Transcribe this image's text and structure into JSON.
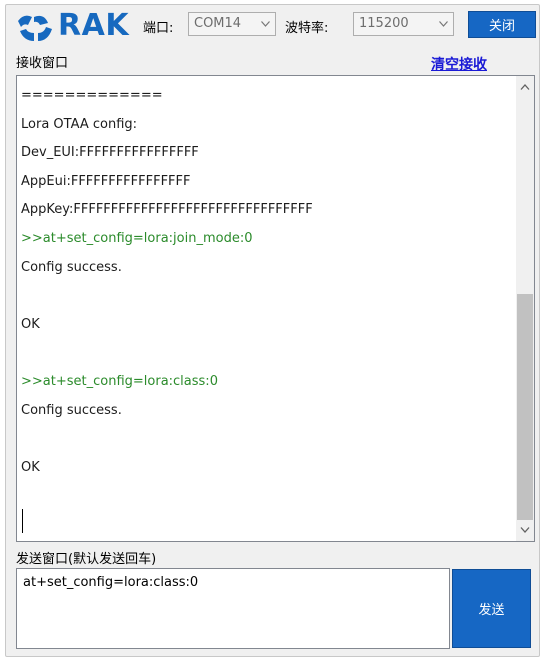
{
  "app": {
    "logo_text": "RAK",
    "brand_color": "#1769bf"
  },
  "header": {
    "port_label": "端口:",
    "port_value": "COM14",
    "baud_label": "波特率:",
    "baud_value": "115200",
    "close_label": "关闭"
  },
  "receive": {
    "section_label": "接收窗口",
    "clear_label": "清空接收",
    "lines": [
      {
        "text": "=============",
        "type": "text"
      },
      {
        "text": "Lora OTAA config:",
        "type": "text"
      },
      {
        "text": "Dev_EUI:FFFFFFFFFFFFFFFF",
        "type": "text"
      },
      {
        "text": "AppEui:FFFFFFFFFFFFFFFF",
        "type": "text"
      },
      {
        "text": "AppKey:FFFFFFFFFFFFFFFFFFFFFFFFFFFFFFFF",
        "type": "text"
      },
      {
        "text": ">>at+set_config=lora:join_mode:0",
        "type": "cmd"
      },
      {
        "text": "Config success.",
        "type": "text"
      },
      {
        "text": "",
        "type": "text"
      },
      {
        "text": "OK",
        "type": "text"
      },
      {
        "text": "",
        "type": "text"
      },
      {
        "text": ">>at+set_config=lora:class:0",
        "type": "cmd"
      },
      {
        "text": "Config success.",
        "type": "text"
      },
      {
        "text": "",
        "type": "text"
      },
      {
        "text": "OK",
        "type": "text"
      }
    ]
  },
  "send": {
    "section_label": "发送窗口(默认发送回车)",
    "input_value": "at+set_config=lora:class:0",
    "send_label": "发送"
  },
  "colors": {
    "accent": "#1667c4",
    "cmd_text": "#2b8b2b",
    "link": "#1a1ad6"
  }
}
